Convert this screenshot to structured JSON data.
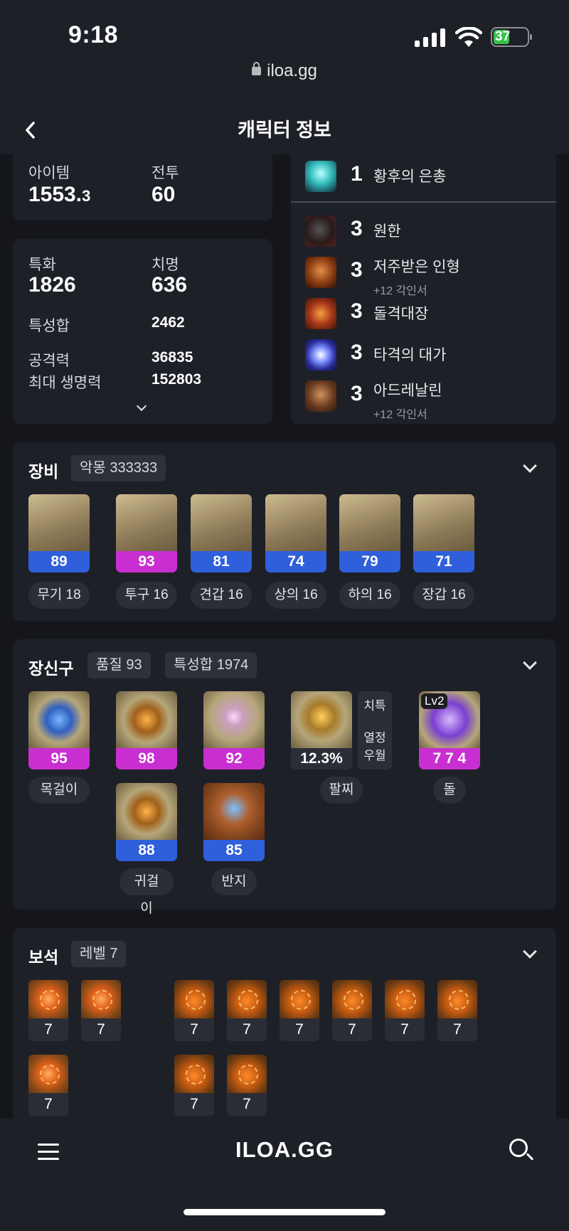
{
  "status": {
    "time": "9:18",
    "battery": "37"
  },
  "browser": {
    "url": "iloa.gg"
  },
  "header": {
    "title": "캐릭터 정보"
  },
  "stats": {
    "item_label": "아이템",
    "item_value_main": "1553.",
    "item_value_dec": "3",
    "battle_label": "전투",
    "battle_value": "60",
    "spec_label": "특화",
    "spec_value": "1826",
    "crit_label": "치명",
    "crit_value": "636",
    "sum_label": "특성합",
    "sum_value": "2462",
    "atk_label": "공격력",
    "atk_value": "36835",
    "hp_label": "최대 생명력",
    "hp_value": "152803"
  },
  "engravings": [
    {
      "level": "1",
      "name": "황후의 은총",
      "sub": ""
    },
    {
      "level": "3",
      "name": "원한",
      "sub": ""
    },
    {
      "level": "3",
      "name": "저주받은 인형",
      "sub": "+12 각인서"
    },
    {
      "level": "3",
      "name": "돌격대장",
      "sub": ""
    },
    {
      "level": "3",
      "name": "타격의 대가",
      "sub": ""
    },
    {
      "level": "3",
      "name": "아드레날린",
      "sub": "+12 각인서"
    }
  ],
  "equipment": {
    "title": "장비",
    "chip": "악몽 333333",
    "items": [
      {
        "quality": "89",
        "label": "무기 18",
        "color": "#2f5fdb"
      },
      {
        "quality": "93",
        "label": "투구 16",
        "color": "#c92fd0"
      },
      {
        "quality": "81",
        "label": "견갑 16",
        "color": "#2f5fdb"
      },
      {
        "quality": "74",
        "label": "상의 16",
        "color": "#2f5fdb"
      },
      {
        "quality": "79",
        "label": "하의 16",
        "color": "#2f5fdb"
      },
      {
        "quality": "71",
        "label": "장갑 16",
        "color": "#2f5fdb"
      }
    ]
  },
  "accessories": {
    "title": "장신구",
    "chip1": "품질 93",
    "chip2": "특성합 1974",
    "necklace": {
      "quality": "95",
      "label": "목걸이"
    },
    "earring1": {
      "quality": "98"
    },
    "ring1": {
      "quality": "92"
    },
    "bracelet": {
      "value": "12.3%",
      "label": "팔찌",
      "side1": "치특",
      "side2": "열정",
      "side3": "우월"
    },
    "stone": {
      "lv": "Lv2",
      "value": "7 7 4",
      "label": "돌"
    },
    "earring2": {
      "quality": "88",
      "label": "귀걸이"
    },
    "ring2": {
      "quality": "85",
      "label": "반지"
    }
  },
  "gems": {
    "title": "보석",
    "chip": "레벨 7",
    "levels": [
      "7",
      "7",
      "7",
      "7",
      "7",
      "7",
      "7",
      "7",
      "7",
      "7",
      "7"
    ]
  },
  "bottom": {
    "logo": "ILOA.GG"
  }
}
